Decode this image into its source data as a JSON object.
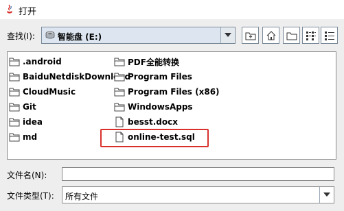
{
  "window": {
    "title": "打开"
  },
  "lookin": {
    "label": "查找(I):",
    "value": "智能盘 (E:)"
  },
  "toolbar": [
    "up-one-level",
    "home",
    "new-folder",
    "list-view",
    "details-view"
  ],
  "files": {
    "col1": [
      ".android",
      "BaiduNetdiskDownload",
      "CloudMusic",
      "Git",
      "idea",
      "md"
    ],
    "col2": [
      "PDF全能转换",
      "Program Files",
      "Program Files (x86)",
      "WindowsApps",
      "besst.docx",
      "online-test.sql"
    ]
  },
  "filename": {
    "label": "文件名(N):",
    "value": ""
  },
  "filetype": {
    "label": "文件类型(T):",
    "value": "所有文件"
  },
  "colors": {
    "highlight": "#d9302c",
    "combo_bg": "#dde6f0"
  }
}
